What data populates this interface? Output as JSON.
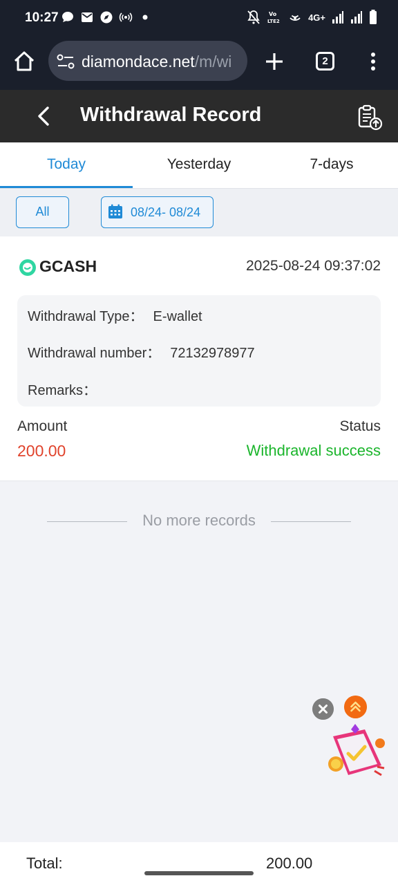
{
  "status_bar": {
    "time": "10:27",
    "network": "4G+",
    "icons": [
      "chat-icon",
      "mail-icon",
      "compass-icon",
      "hotspot-icon",
      "dot-icon",
      "mute-icon",
      "volte-icon",
      "wifi-icon",
      "signal-icon",
      "battery-icon"
    ]
  },
  "browser": {
    "url_domain": "diamondace.net",
    "url_path": "/m/wi",
    "tab_count": "2"
  },
  "header": {
    "title": "Withdrawal Record"
  },
  "tabs": [
    {
      "label": "Today",
      "active": true
    },
    {
      "label": "Yesterday",
      "active": false
    },
    {
      "label": "7-days",
      "active": false
    }
  ],
  "filters": {
    "all_label": "All",
    "date_range": "08/24- 08/24"
  },
  "record": {
    "method": "GCASH",
    "datetime": "2025-08-24 09:37:02",
    "type_label": "Withdrawal Type：",
    "type_value": "E-wallet",
    "number_label": "Withdrawal number：",
    "number_value": "72132978977",
    "remarks_label": "Remarks：",
    "remarks_value": "",
    "amount_label": "Amount",
    "amount_value": "200.00",
    "status_label": "Status",
    "status_value": "Withdrawal success"
  },
  "list_end_text": "No more records",
  "footer": {
    "total_label": "Total:",
    "total_value": "200.00"
  },
  "colors": {
    "accent": "#1f8ad6",
    "amount": "#e0432c",
    "success": "#1bb52c",
    "header_bg": "#2b2b2b",
    "browser_bg": "#1a1f2b"
  }
}
